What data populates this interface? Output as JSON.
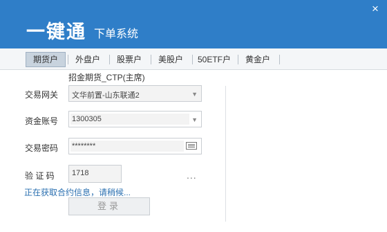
{
  "header": {
    "logo": "一键通",
    "subtitle": "下单系统",
    "close": "×"
  },
  "tabs": [
    {
      "label": "期货户",
      "active": true
    },
    {
      "label": "外盘户",
      "active": false
    },
    {
      "label": "股票户",
      "active": false
    },
    {
      "label": "美股户",
      "active": false
    },
    {
      "label": "50ETF户",
      "active": false
    },
    {
      "label": "黄金户",
      "active": false
    }
  ],
  "form": {
    "broker_note": "招金期货_CTP(主席)",
    "gateway": {
      "label": "交易网关",
      "value": "文华前置-山东联通2"
    },
    "account": {
      "label": "资金账号",
      "value": "1300305"
    },
    "password": {
      "label": "交易密码",
      "value": "********"
    },
    "captcha": {
      "label": "验 证 码",
      "value": "1718"
    },
    "more": "...",
    "status": "正在获取合约信息，请稍候...",
    "login": "登录"
  },
  "colors": {
    "header_bg": "#2f7ec8",
    "status_text": "#2a6fb0"
  }
}
